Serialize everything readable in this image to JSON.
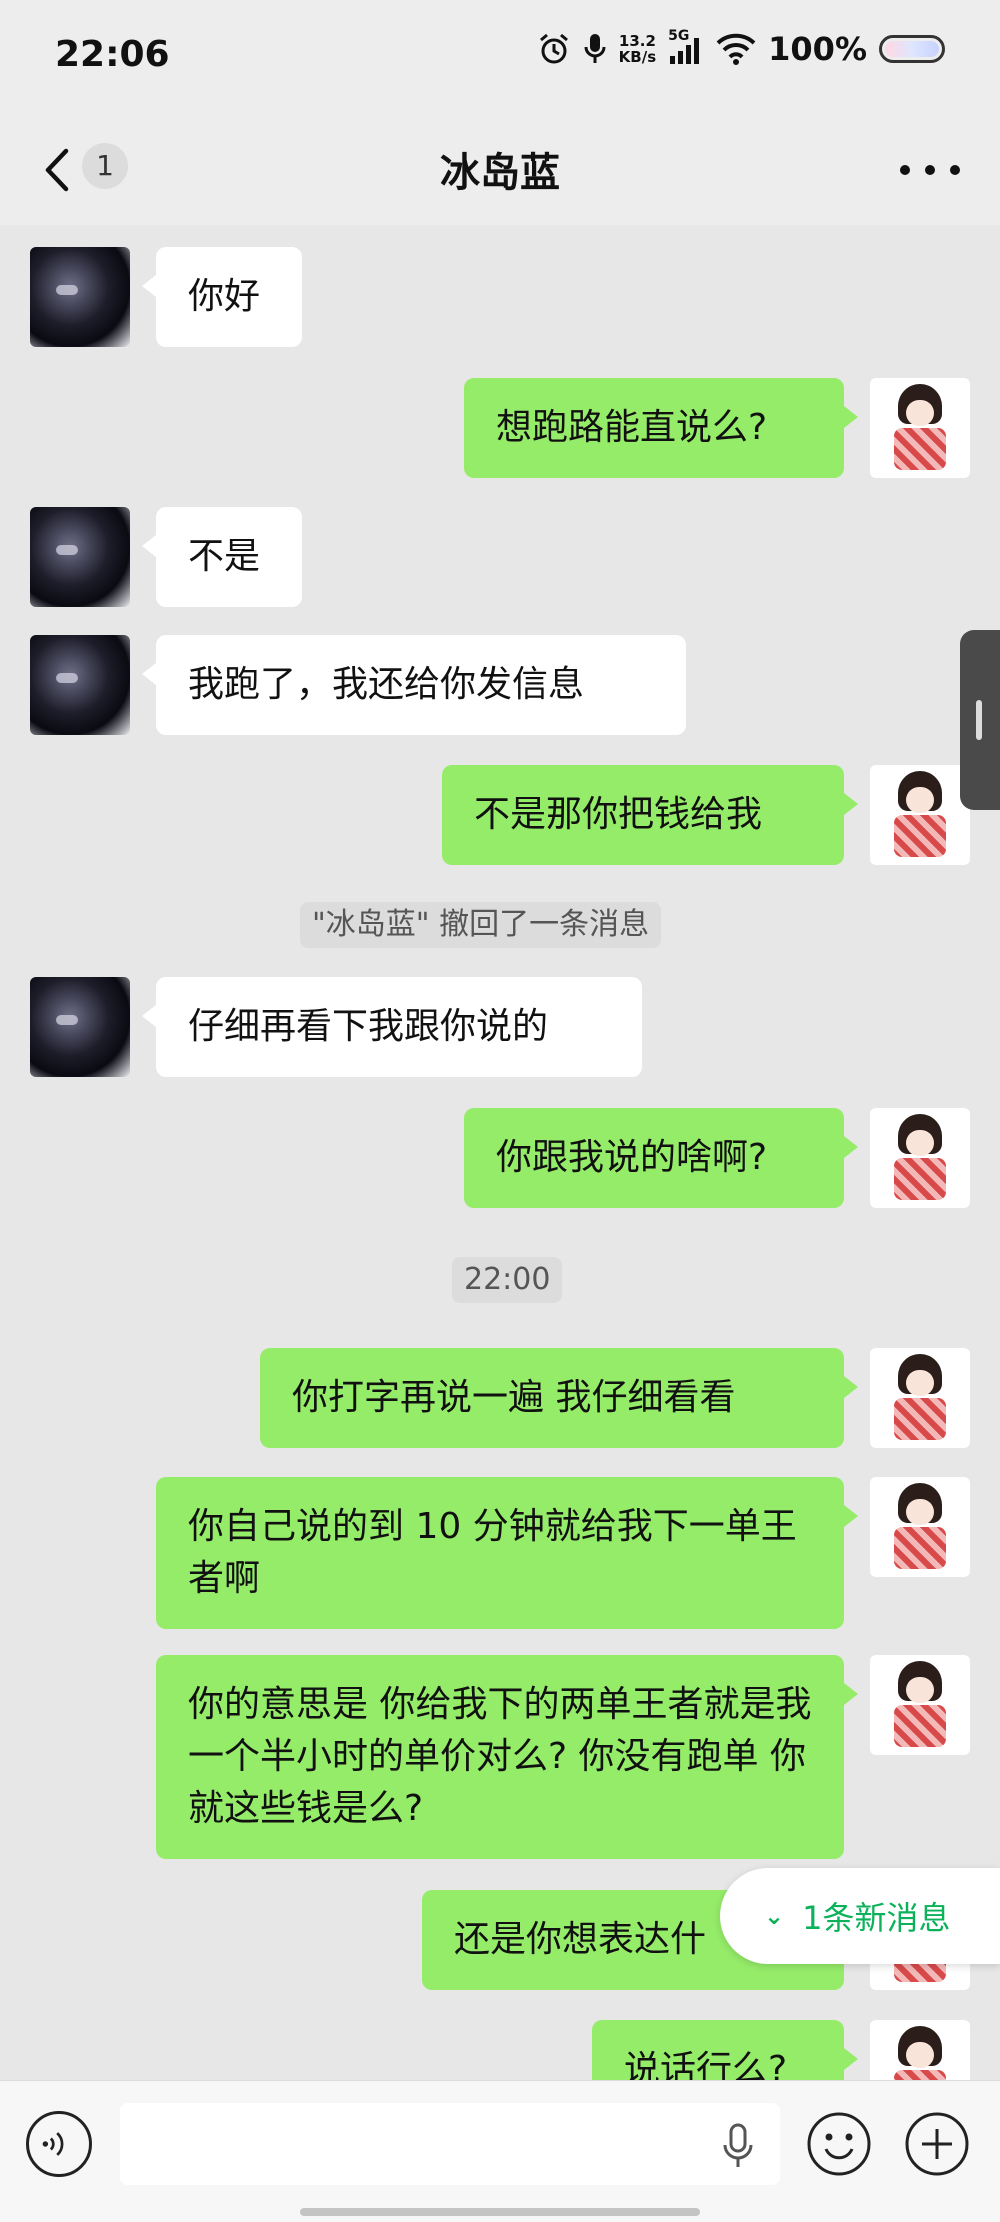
{
  "status_bar": {
    "time": "22:06",
    "net_speed_top": "13.2",
    "net_speed_bottom": "KB/s",
    "network": "5G",
    "battery": "100%"
  },
  "header": {
    "unread_count": "1",
    "title": "冰岛蓝"
  },
  "messages": [
    {
      "from": "other",
      "text": "你好"
    },
    {
      "from": "self",
      "text": "想跑路能直说么?"
    },
    {
      "from": "other",
      "text": "不是"
    },
    {
      "from": "other",
      "text": "我跑了，我还给你发信息"
    },
    {
      "from": "self",
      "text": "不是那你把钱给我"
    },
    {
      "from": "system",
      "text": "\"冰岛蓝\" 撤回了一条消息"
    },
    {
      "from": "other",
      "text": "仔细再看下我跟你说的"
    },
    {
      "from": "self",
      "text": "你跟我说的啥啊?"
    },
    {
      "from": "system",
      "text": "22:00"
    },
    {
      "from": "self",
      "text": "你打字再说一遍 我仔细看看"
    },
    {
      "from": "self",
      "text": "你自己说的到 10 分钟就给我下一单王者啊"
    },
    {
      "from": "self",
      "text": "你的意思是 你给我下的两单王者就是我一个半小时的单价对么? 你没有跑单 你就这些钱是么?"
    },
    {
      "from": "self",
      "text": "还是你想表达什"
    },
    {
      "from": "self",
      "text": "说话行么?"
    }
  ],
  "new_messages_pill": "1条新消息",
  "input": {
    "placeholder": ""
  },
  "colors": {
    "self_bubble": "#95ec69",
    "other_bubble": "#ffffff",
    "accent": "#0bb25a"
  }
}
